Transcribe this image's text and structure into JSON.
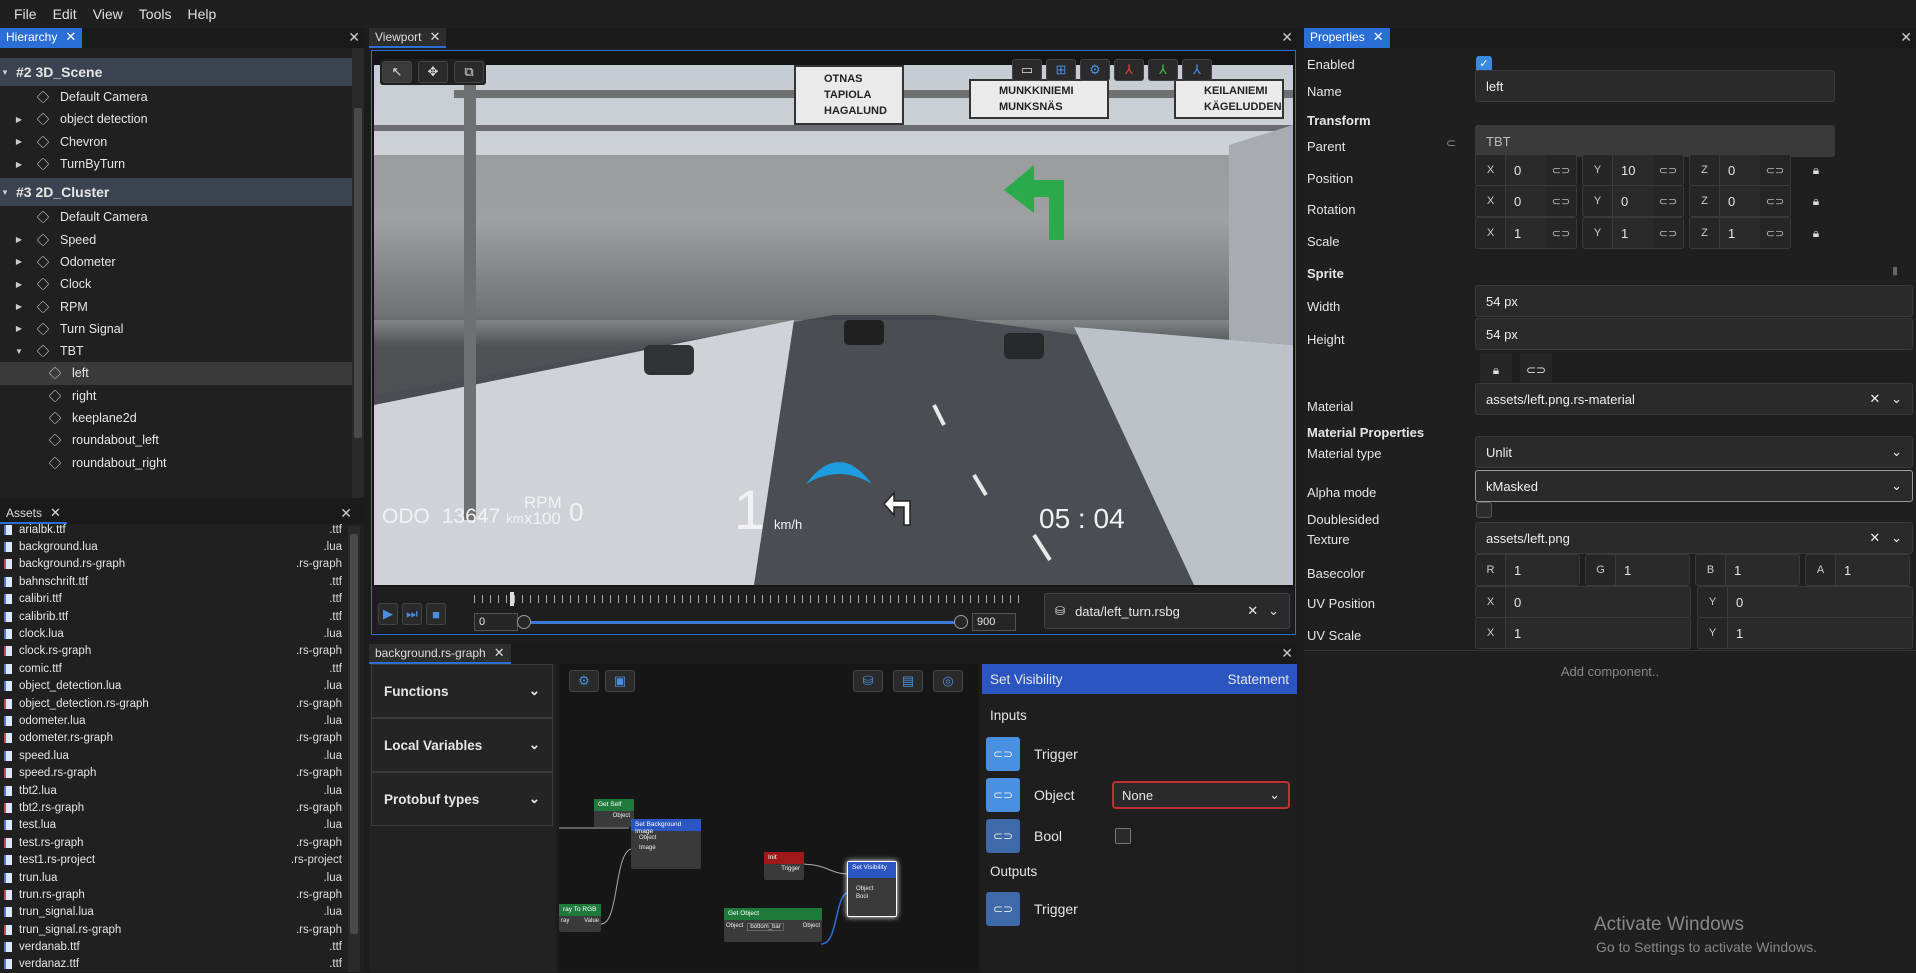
{
  "menu": [
    "File",
    "Edit",
    "View",
    "Tools",
    "Help"
  ],
  "hierarchy": {
    "tab": "Hierarchy",
    "groups": [
      {
        "label": "#2 3D_Scene",
        "items": [
          {
            "label": "Default Camera",
            "exp": false
          },
          {
            "label": "object detection",
            "exp": true
          },
          {
            "label": "Chevron",
            "exp": true
          },
          {
            "label": "TurnByTurn",
            "exp": true
          }
        ]
      },
      {
        "label": "#3 2D_Cluster",
        "items": [
          {
            "label": "Default Camera",
            "exp": false
          },
          {
            "label": "Speed",
            "exp": true
          },
          {
            "label": "Odometer",
            "exp": true
          },
          {
            "label": "Clock",
            "exp": true
          },
          {
            "label": "RPM",
            "exp": true
          },
          {
            "label": "Turn Signal",
            "exp": true
          },
          {
            "label": "TBT",
            "exp": true,
            "open": true
          }
        ]
      }
    ],
    "tbt_children": [
      "left",
      "right",
      "keeplane2d",
      "roundabout_left",
      "roundabout_right"
    ],
    "selected": "left"
  },
  "assets": {
    "tab": "Assets",
    "files": [
      [
        "arialbk.ttf",
        ".ttf"
      ],
      [
        "background.lua",
        ".lua"
      ],
      [
        "background.rs-graph",
        ".rs-graph"
      ],
      [
        "bahnschrift.ttf",
        ".ttf"
      ],
      [
        "calibri.ttf",
        ".ttf"
      ],
      [
        "calibrib.ttf",
        ".ttf"
      ],
      [
        "clock.lua",
        ".lua"
      ],
      [
        "clock.rs-graph",
        ".rs-graph"
      ],
      [
        "comic.ttf",
        ".ttf"
      ],
      [
        "object_detection.lua",
        ".lua"
      ],
      [
        "object_detection.rs-graph",
        ".rs-graph"
      ],
      [
        "odometer.lua",
        ".lua"
      ],
      [
        "odometer.rs-graph",
        ".rs-graph"
      ],
      [
        "speed.lua",
        ".lua"
      ],
      [
        "speed.rs-graph",
        ".rs-graph"
      ],
      [
        "tbt2.lua",
        ".lua"
      ],
      [
        "tbt2.rs-graph",
        ".rs-graph"
      ],
      [
        "test.lua",
        ".lua"
      ],
      [
        "test.rs-graph",
        ".rs-graph"
      ],
      [
        "test1.rs-project",
        ".rs-project"
      ],
      [
        "trun.lua",
        ".lua"
      ],
      [
        "trun.rs-graph",
        ".rs-graph"
      ],
      [
        "trun_signal.lua",
        ".lua"
      ],
      [
        "trun_signal.rs-graph",
        ".rs-graph"
      ],
      [
        "verdanab.ttf",
        ".ttf"
      ],
      [
        "verdanaz.ttf",
        ".ttf"
      ]
    ]
  },
  "viewport": {
    "tab": "Viewport",
    "signs": [
      "OTNAS",
      "TAPIOLA",
      "HAGALUND",
      "MUNKKINIEMI",
      "MUNKSNÄS",
      "KEILANIEMI",
      "KÄGELUDDEN",
      "UNKSNÄS"
    ],
    "odo_label": "ODO",
    "odo_value": "13647",
    "odo_unit": "km",
    "rpm_label": "RPM",
    "rpm_sub": "x100",
    "rpm_value": "0",
    "speed": "1",
    "speed_unit": "km/h",
    "clock_h": "05",
    "clock_m": "04",
    "timeline": {
      "start": "0",
      "end": "900",
      "position": 0.04
    },
    "data_file": "data/left_turn.rsbg"
  },
  "graph": {
    "tab": "background.rs-graph",
    "sections": [
      "Functions",
      "Local Variables",
      "Protobuf types"
    ],
    "nodes": {
      "get_self": "Get Self",
      "get_self_port": "Object",
      "set_bg": "Set Background Image",
      "set_bg_ports": [
        "Object",
        "Image"
      ],
      "gray": "ray To RGB",
      "gray_ports": [
        "ray",
        "Value"
      ],
      "init": "Init",
      "init_port": "Trigger",
      "get_obj": "Get Object",
      "get_obj_ports": [
        "Object",
        "bottom_bar",
        "Object"
      ],
      "set_vis": "Set Visibility",
      "set_vis_ports": [
        "Object",
        "Bool"
      ]
    },
    "inspector": {
      "title": "Set Visibility",
      "kind": "Statement",
      "inputs": "Inputs",
      "outputs": "Outputs",
      "trigger": "Trigger",
      "object": "Object",
      "object_value": "None",
      "bool": "Bool",
      "out_trigger": "Trigger"
    }
  },
  "props": {
    "tab": "Properties",
    "enabled": "Enabled",
    "name_label": "Name",
    "name": "left",
    "transform": "Transform",
    "parent_label": "Parent",
    "parent": "TBT",
    "position_label": "Position",
    "rotation_label": "Rotation",
    "scale_label": "Scale",
    "position": [
      "0",
      "10",
      "0"
    ],
    "rotation": [
      "0",
      "0",
      "0"
    ],
    "scale": [
      "1",
      "1",
      "1"
    ],
    "sprite": "Sprite",
    "width_label": "Width",
    "width": "54 px",
    "height_label": "Height",
    "height": "54 px",
    "material_label": "Material",
    "material": "assets/left.png.rs-material",
    "mat_props": "Material Properties",
    "mat_type_label": "Material type",
    "mat_type": "Unlit",
    "alpha_label": "Alpha mode",
    "alpha": "kMasked",
    "double_label": "Doublesided",
    "texture_label": "Texture",
    "texture": "assets/left.png",
    "basecolor_label": "Basecolor",
    "basecolor": [
      "1",
      "1",
      "1",
      "1"
    ],
    "uvpos_label": "UV Position",
    "uvpos": [
      "0",
      "0"
    ],
    "uvscale_label": "UV Scale",
    "uvscale": [
      "1",
      "1"
    ],
    "add": "Add component..",
    "watermark1": "Activate Windows",
    "watermark2": "Go to Settings to activate Windows."
  }
}
